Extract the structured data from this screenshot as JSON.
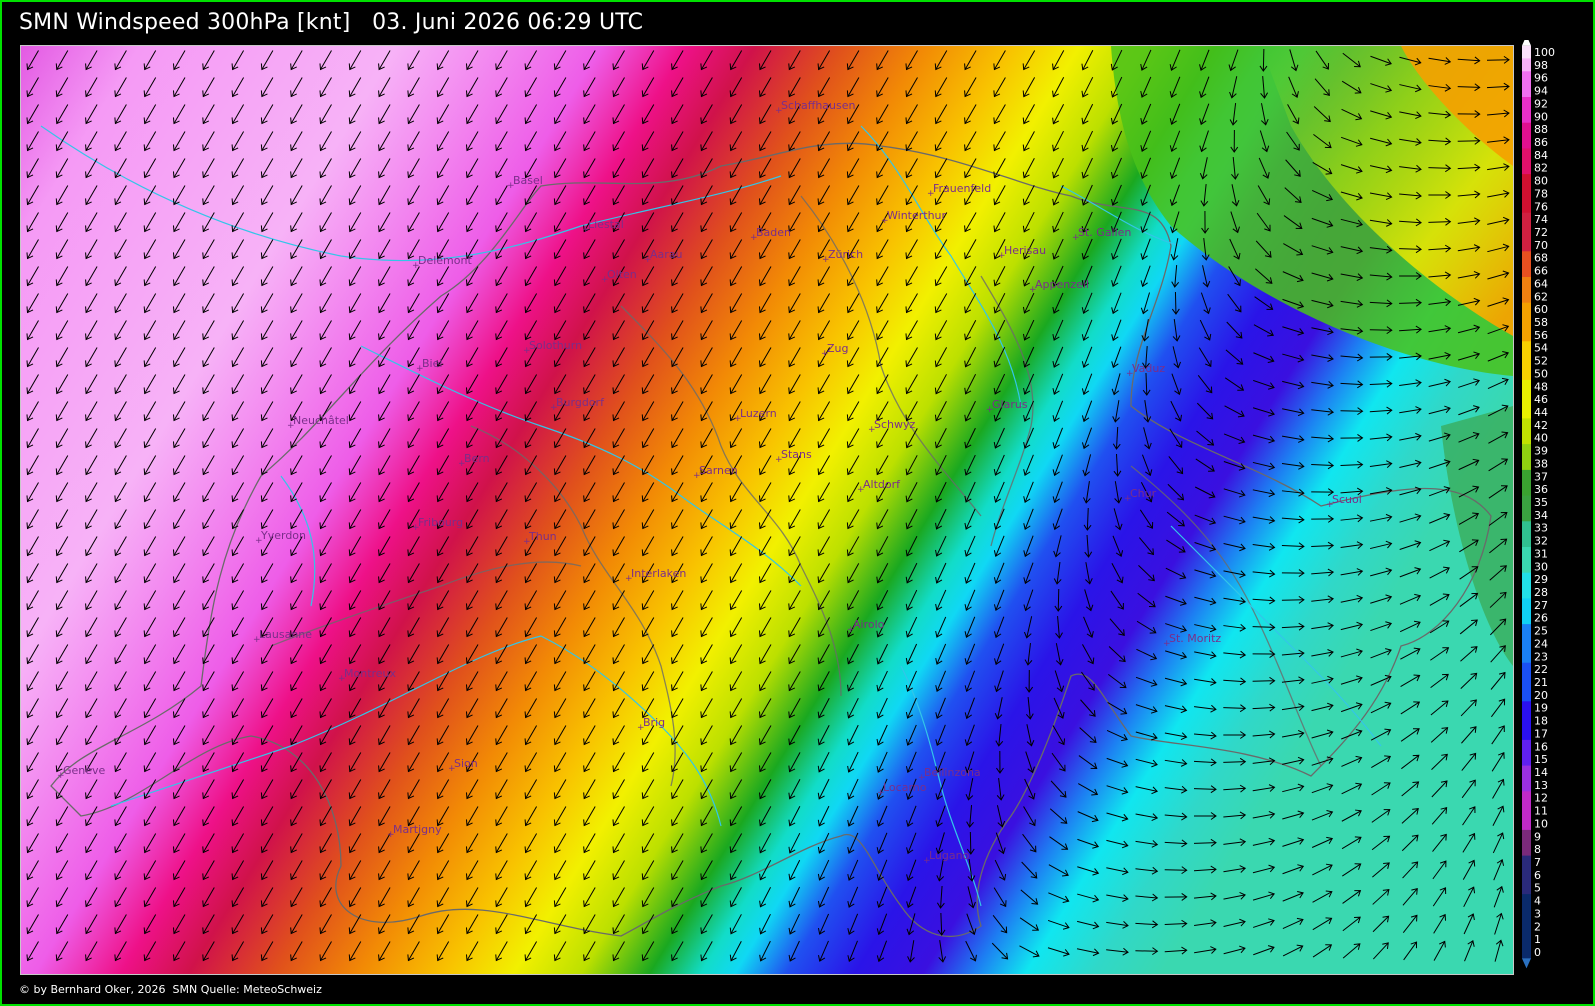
{
  "header": {
    "title": "SMN Windspeed 300hPa [knt]",
    "datetime": "03. Juni 2026 06:29 UTC"
  },
  "footer": {
    "copyright": "© by Bernhard Oker, 2026",
    "source": "SMN Quelle: MeteoSchweiz"
  },
  "legend": {
    "ticks": [
      "100",
      "98",
      "96",
      "94",
      "92",
      "90",
      "88",
      "86",
      "84",
      "82",
      "80",
      "78",
      "76",
      "74",
      "72",
      "70",
      "68",
      "66",
      "64",
      "62",
      "60",
      "58",
      "56",
      "54",
      "52",
      "50",
      "48",
      "46",
      "44",
      "42",
      "40",
      "39",
      "38",
      "37",
      "36",
      "35",
      "34",
      "33",
      "32",
      "31",
      "30",
      "29",
      "28",
      "27",
      "26",
      "25",
      "24",
      "23",
      "22",
      "21",
      "20",
      "19",
      "18",
      "17",
      "16",
      "15",
      "14",
      "13",
      "12",
      "11",
      "10",
      "9",
      "8",
      "7",
      "6",
      "5",
      "4",
      "3",
      "2",
      "1",
      "0"
    ]
  },
  "map": {
    "cities": [
      "Schaffhausen",
      "Basel",
      "Liestal",
      "Frauenfeld",
      "Winterthur",
      "St. Gallen",
      "Baden",
      "Delémont",
      "Aarau",
      "Olten",
      "Zürich",
      "Herisau",
      "Appenzell",
      "Solothurn",
      "Zug",
      "Vaduz",
      "Biel",
      "Burgdorf",
      "Glarus",
      "Neuchâtel",
      "Luzern",
      "Schwyz",
      "Bern",
      "Sarnen",
      "Stans",
      "Altdorf",
      "Chur",
      "Scuol",
      "Fribourg",
      "Yverdon",
      "Thun",
      "Interlaken",
      "Airolo",
      "Lausanne",
      "St. Moritz",
      "Montreux",
      "Brig",
      "Genève",
      "Sion",
      "Bellinzona",
      "Locarno",
      "Martigny",
      "Lugano"
    ]
  },
  "colors": {
    "frame_border": "#00e000",
    "background": "#000000",
    "arrow": "#000000",
    "city_label": "#7a2e8a",
    "border_line": "#6a6a6a",
    "river_line": "#33c6e8"
  }
}
